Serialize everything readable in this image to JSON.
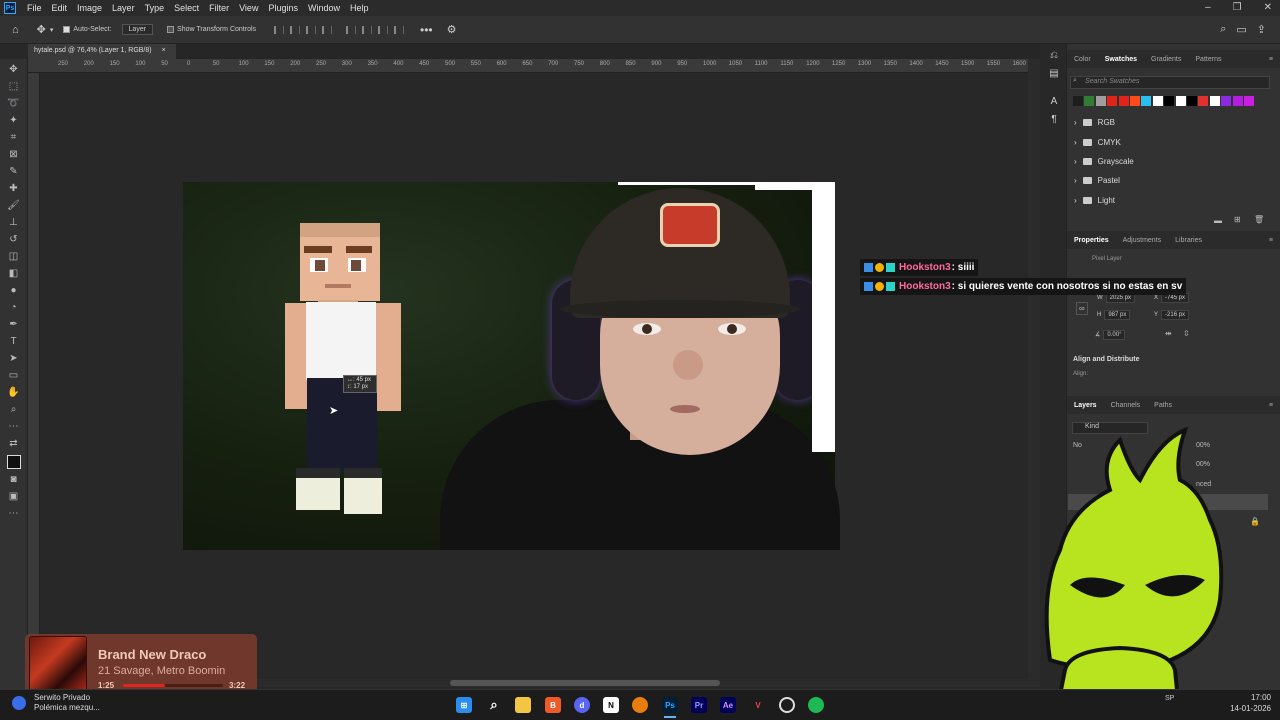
{
  "menubar": {
    "logo": "Ps",
    "items": [
      "File",
      "Edit",
      "Image",
      "Layer",
      "Type",
      "Select",
      "Filter",
      "View",
      "Plugins",
      "Window",
      "Help"
    ]
  },
  "options": {
    "auto_select_label": "Auto-Select:",
    "auto_select_target": "Layer",
    "show_transform_label": "Show Transform Controls"
  },
  "document": {
    "tab_title": "hytale.psd @ 76,4% (Layer 1, RGB/8)",
    "close_glyph": "×"
  },
  "ruler_ticks": [
    "250",
    "200",
    "150",
    "100",
    "50",
    "0",
    "50",
    "100",
    "150",
    "200",
    "250",
    "300",
    "350",
    "400",
    "450",
    "500",
    "550",
    "600",
    "650",
    "700",
    "750",
    "800",
    "850",
    "900",
    "950",
    "1000",
    "1050",
    "1100",
    "1150",
    "1200",
    "1250",
    "1300",
    "1350",
    "1400",
    "1450",
    "1500",
    "1550",
    "1600"
  ],
  "measure": {
    "dx": "↔: 45 px",
    "dy": "↕: 17 px"
  },
  "swatches_panel": {
    "tabs": [
      "Color",
      "Swatches",
      "Gradients",
      "Patterns"
    ],
    "active_tab": "Swatches",
    "search_placeholder": "Search Swatches",
    "colors": [
      "#1d1d1d",
      "#2f7d32",
      "#9e9e9e",
      "#e0241b",
      "#e0241b",
      "#ff4a1a",
      "#29c0f0",
      "#ffffff",
      "#000000",
      "#ffffff",
      "#000000",
      "#e03030",
      "#ffffff",
      "#8a2be2",
      "#b21ee0",
      "#c81ee0"
    ],
    "groups": [
      "RGB",
      "CMYK",
      "Grayscale",
      "Pastel",
      "Light"
    ]
  },
  "properties_panel": {
    "tabs": [
      "Properties",
      "Adjustments",
      "Libraries"
    ],
    "active_tab": "Properties",
    "kind": "Pixel Layer",
    "w_label": "W",
    "w_value": "2025 px",
    "x_label": "X",
    "x_value": "-745 px",
    "h_label": "H",
    "h_value": "987 px",
    "y_label": "Y",
    "y_value": "-216 px",
    "angle_value": "0.00°",
    "align_heading": "Align and Distribute",
    "align_label": "Align:"
  },
  "layers_panel": {
    "tabs": [
      "Layers",
      "Channels",
      "Paths"
    ],
    "active_tab": "Layers",
    "kind_filter": "Kind",
    "blend_mode": "No",
    "opacity": "00%",
    "fill": "00%",
    "snippet": "nced"
  },
  "chat": [
    {
      "user": "Hookston3",
      "message": ": siiii"
    },
    {
      "user": "Hookston3",
      "message": ": si quieres vente con nosotros si no estas en sv"
    }
  ],
  "now_playing": {
    "title": "Brand New Draco",
    "artist": "21 Savage, Metro Boomin",
    "elapsed": "1:25",
    "duration": "3:22",
    "progress_fraction": 0.42
  },
  "taskbar": {
    "news_line1": "Serwito Privado",
    "news_line2": "Polémica mezqu...",
    "apps": [
      "windows-start",
      "search",
      "file-explorer",
      "brave",
      "discord",
      "notion",
      "blender",
      "photoshop",
      "premiere",
      "after-effects",
      "vegas",
      "obs",
      "spotify"
    ],
    "sys_text": "SP",
    "time": "17:00",
    "date": "14-01-2026"
  }
}
